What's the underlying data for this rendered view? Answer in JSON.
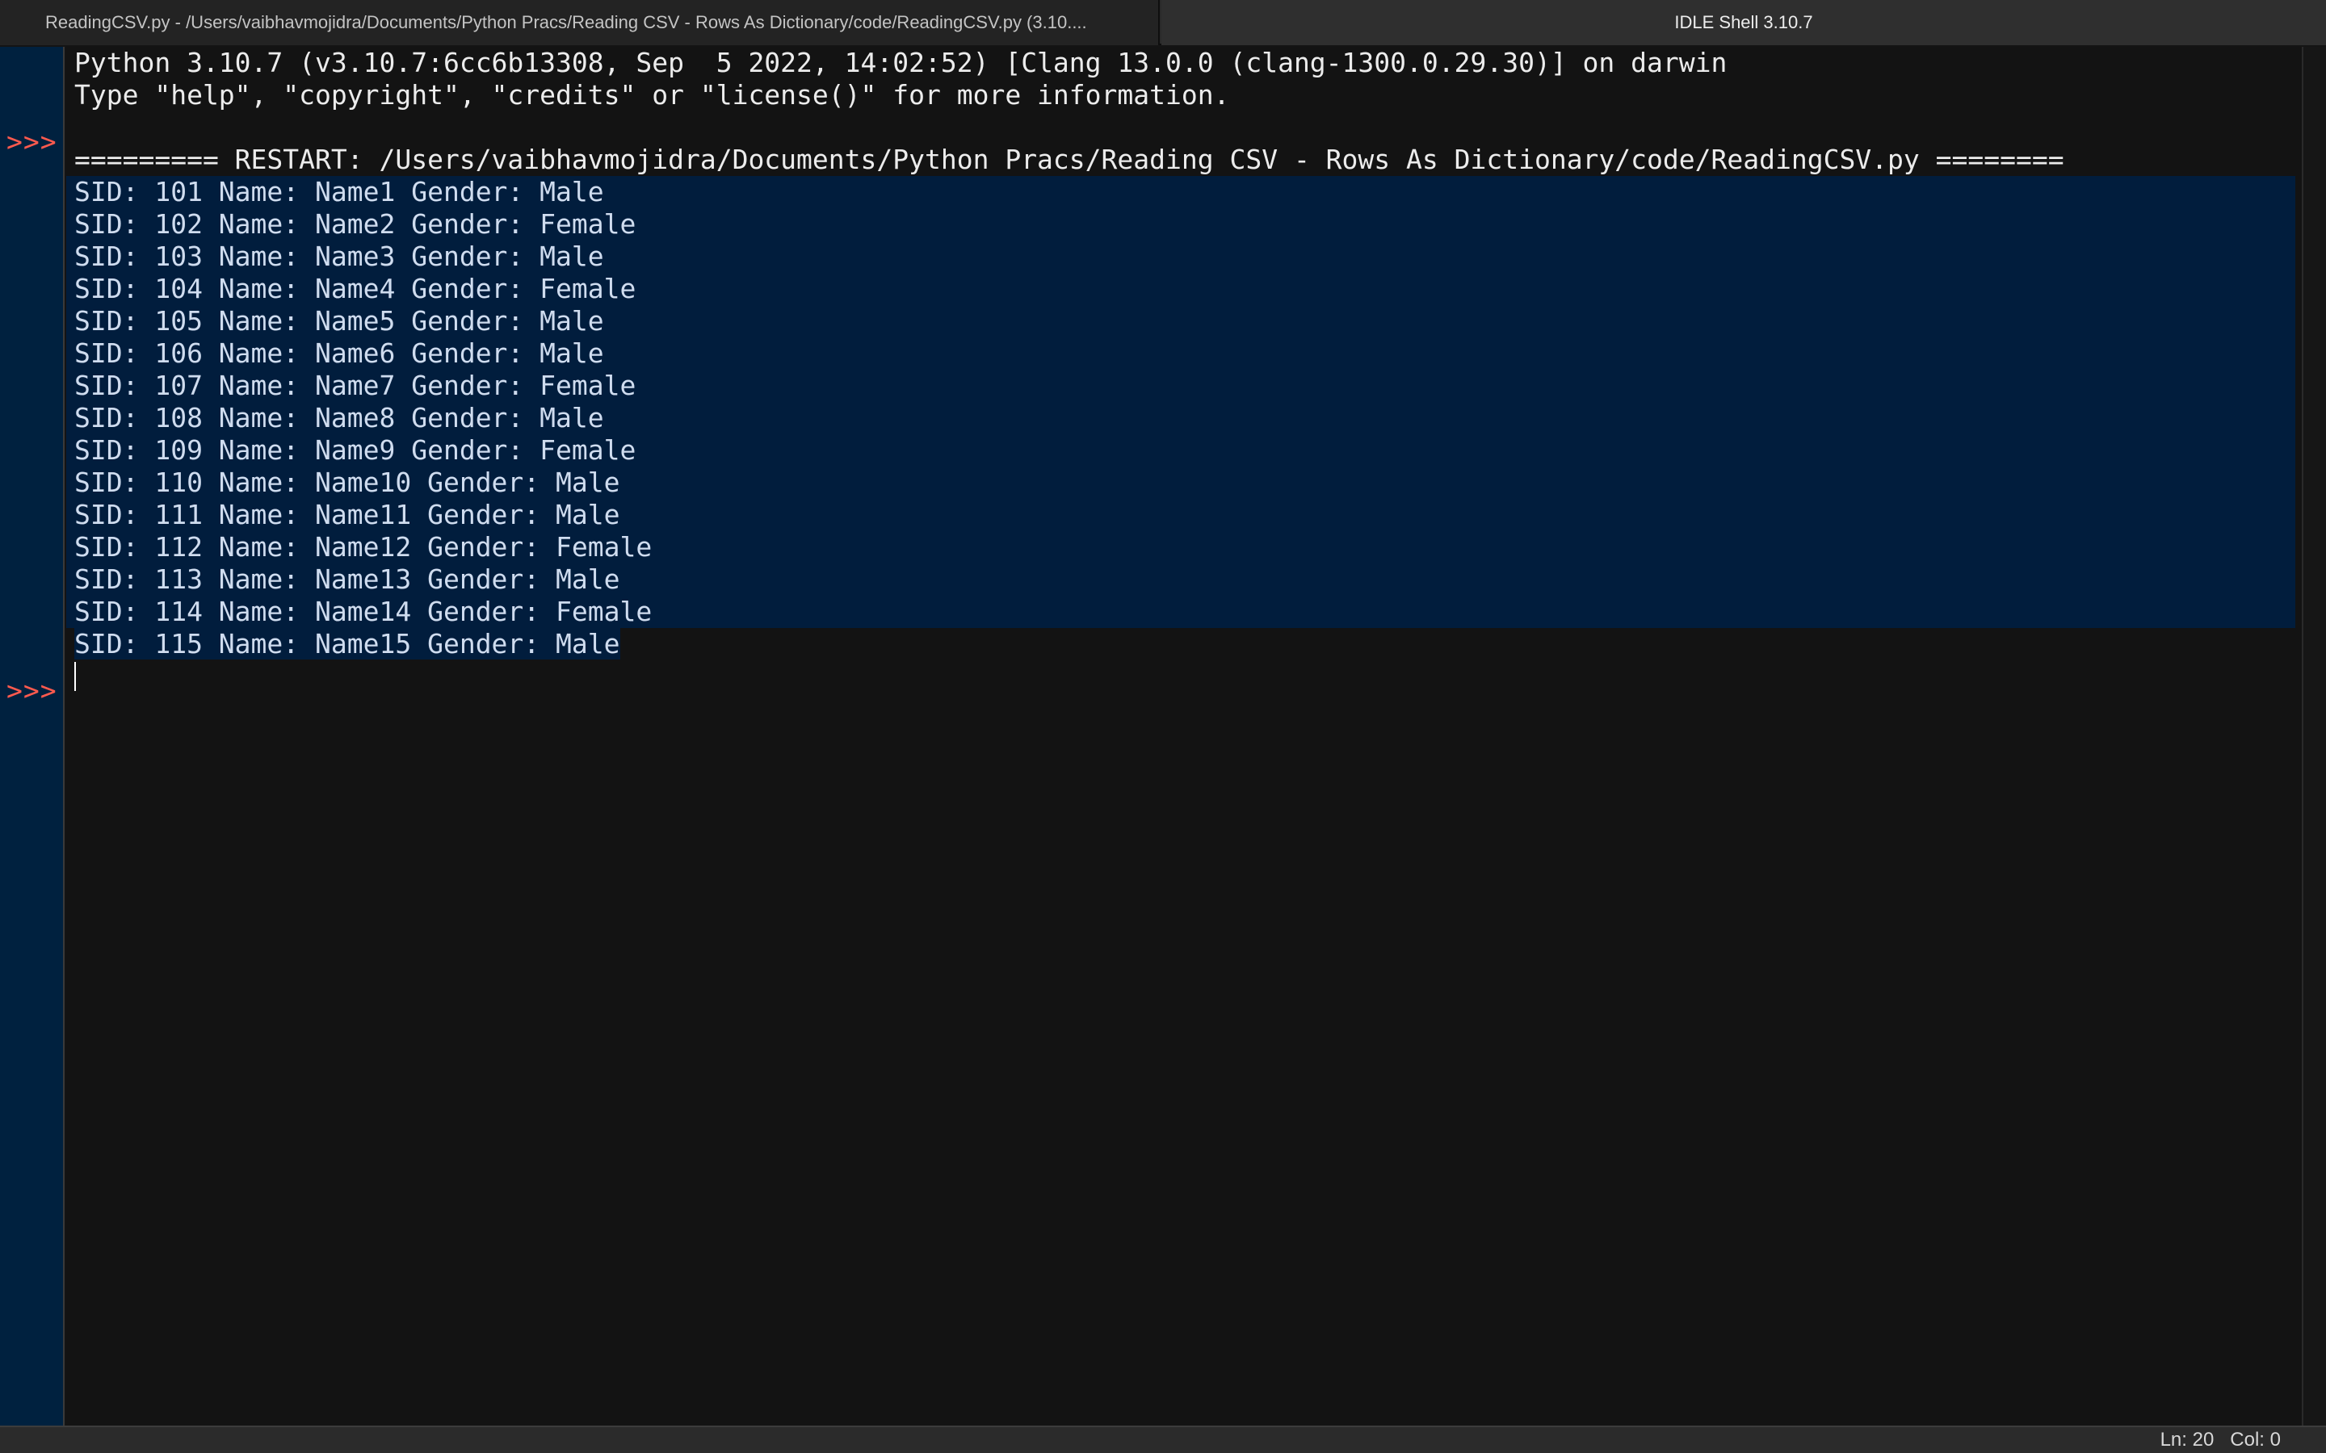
{
  "tabs": {
    "inactive_title": "ReadingCSV.py - /Users/vaibhavmojidra/Documents/Python Pracs/Reading CSV - Rows As Dictionary/code/ReadingCSV.py (3.10....",
    "active_title": "IDLE Shell 3.10.7"
  },
  "shell": {
    "prompt": ">>>",
    "header_line1": "Python 3.10.7 (v3.10.7:6cc6b13308, Sep  5 2022, 14:02:52) [Clang 13.0.0 (clang-1300.0.29.30)] on darwin",
    "header_line2": "Type \"help\", \"copyright\", \"credits\" or \"license()\" for more information.",
    "restart_line": "========= RESTART: /Users/vaibhavmojidra/Documents/Python Pracs/Reading CSV - Rows As Dictionary/code/ReadingCSV.py ========",
    "output": [
      "SID: 101 Name: Name1 Gender: Male",
      "SID: 102 Name: Name2 Gender: Female",
      "SID: 103 Name: Name3 Gender: Male",
      "SID: 104 Name: Name4 Gender: Female",
      "SID: 105 Name: Name5 Gender: Male",
      "SID: 106 Name: Name6 Gender: Male",
      "SID: 107 Name: Name7 Gender: Female",
      "SID: 108 Name: Name8 Gender: Male",
      "SID: 109 Name: Name9 Gender: Female",
      "SID: 110 Name: Name10 Gender: Male",
      "SID: 111 Name: Name11 Gender: Male",
      "SID: 112 Name: Name12 Gender: Female",
      "SID: 113 Name: Name13 Gender: Male",
      "SID: 114 Name: Name14 Gender: Female",
      "SID: 115 Name: Name15 Gender: Male"
    ]
  },
  "status": {
    "position": "Ln: 20   Col: 0"
  },
  "colors": {
    "prompt": "#ff5a4e",
    "selection": "#011d3d",
    "gutter": "#00213f",
    "background": "#131313"
  }
}
